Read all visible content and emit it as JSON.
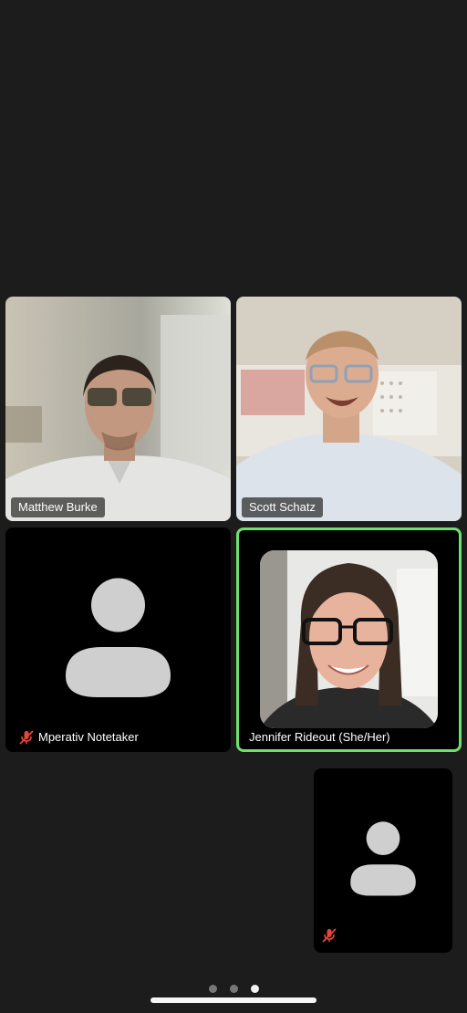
{
  "participants": [
    {
      "name": "Matthew Burke",
      "video": true,
      "muted": false
    },
    {
      "name": "Scott Schatz",
      "video": true,
      "muted": false
    },
    {
      "name": "Mperativ Notetaker",
      "video": false,
      "muted": true
    },
    {
      "name": "Jennifer Rideout (She/Her)",
      "video": true,
      "muted": false,
      "active_speaker": true
    }
  ],
  "self_view": {
    "video": false,
    "muted": true
  },
  "pager": {
    "pages": 3,
    "current": 3
  },
  "colors": {
    "background": "#1c1c1c",
    "active_speaker_border": "#6ee06e",
    "mute_icon": "#e5463b",
    "avatar": "#cfcfcf"
  }
}
